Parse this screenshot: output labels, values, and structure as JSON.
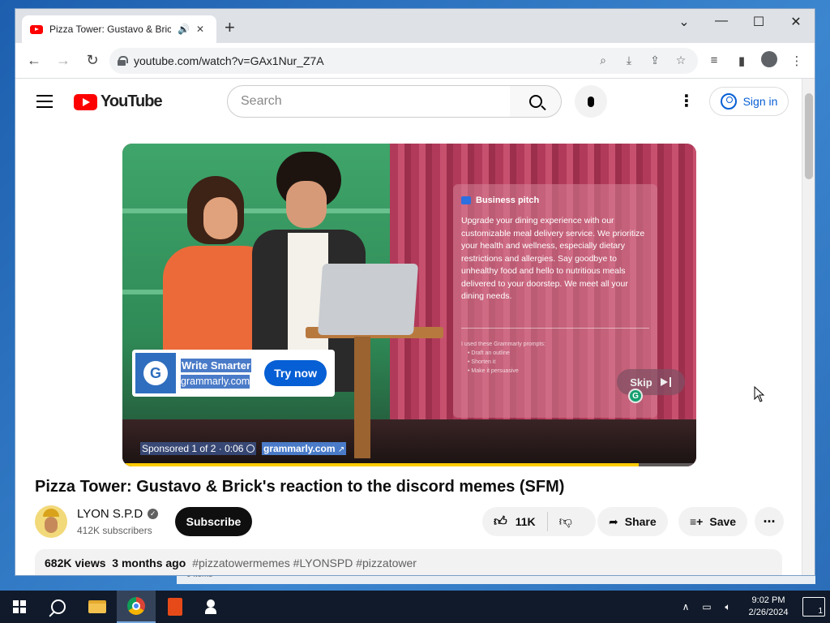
{
  "browser": {
    "tab": {
      "title": "Pizza Tower: Gustavo & Brick's reaction to the discord memes (SFM) - YouTube",
      "audio_icon": "speaker-icon",
      "close_icon": "close-icon"
    },
    "new_tab_label": "+",
    "window_controls": {
      "chevron": "⌄",
      "minimize": "—",
      "maximize": "☐",
      "close": "✕"
    },
    "url": "youtube.com/watch?v=GAx1Nur_Z7A"
  },
  "youtube": {
    "logo_text": "YouTube",
    "search_placeholder": "Search",
    "sign_in": "Sign in"
  },
  "ad": {
    "pitch_title": "Business pitch",
    "pitch_body": "Upgrade your dining experience with our customizable meal delivery service. We prioritize your health and wellness, especially dietary restrictions and allergies. Say goodbye to unhealthy food and hello to nutritious meals delivered to your doorstep. We meet all your dining needs.",
    "prompts_header": "I used these Grammarly prompts:",
    "prompts": [
      "Draft an outline",
      "Shorten it",
      "Make it persuasive"
    ],
    "card_headline": "Write Smarter",
    "card_domain": "grammarly.com",
    "cta": "Try now",
    "skip": "Skip",
    "sponsor": "Sponsored 1 of 2 · 0:06",
    "sponsor_url": "grammarly.com",
    "progress": 0.9
  },
  "video": {
    "title": "Pizza Tower: Gustavo & Brick's reaction to the discord memes (SFM)",
    "channel": "LYON S.P.D",
    "subscribers": "412K subscribers",
    "subscribe": "Subscribe",
    "likes": "11K",
    "share": "Share",
    "save": "Save",
    "views": "682K views",
    "age": "3 months ago",
    "tags": "#pizzatowermemes #LYONSPD #pizzatower"
  },
  "taskbar": {
    "time": "9:02 PM",
    "date": "2/26/2024",
    "notifications": "1"
  },
  "desktop": {
    "behind_text": "0 items"
  }
}
